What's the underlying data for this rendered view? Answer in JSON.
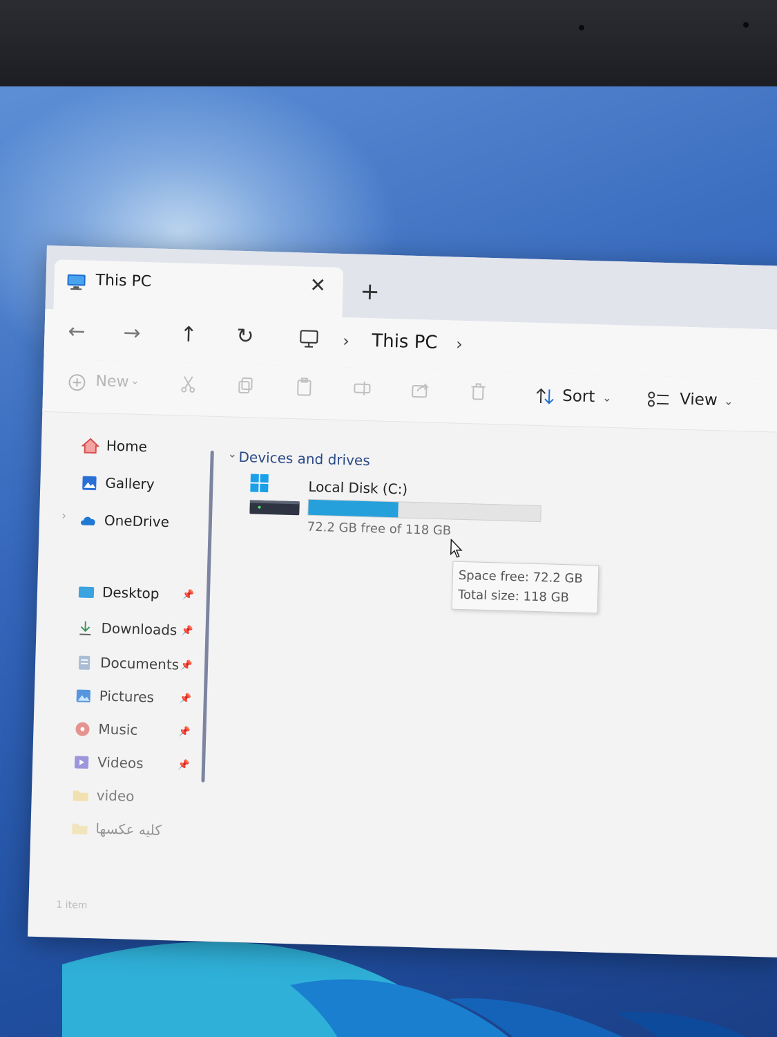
{
  "window": {
    "tab_title": "This PC",
    "close_glyph": "✕",
    "new_tab_glyph": "+"
  },
  "nav": {
    "back_glyph": "←",
    "forward_glyph": "→",
    "up_glyph": "↑",
    "refresh_glyph": "↻",
    "sep_glyph": "›",
    "breadcrumb": "This PC"
  },
  "toolbar": {
    "new_label": "New",
    "new_icon": "plus-circle-icon",
    "sort_label": "Sort",
    "view_label": "View",
    "chevron": "⌄"
  },
  "sidebar": {
    "items": [
      {
        "label": "Home",
        "icon": "home-icon"
      },
      {
        "label": "Gallery",
        "icon": "gallery-icon"
      },
      {
        "label": "OneDrive",
        "icon": "cloud-icon"
      },
      {
        "label": "Desktop",
        "icon": "desktop-folder-icon"
      },
      {
        "label": "Downloads",
        "icon": "download-icon"
      },
      {
        "label": "Documents",
        "icon": "documents-icon"
      },
      {
        "label": "Pictures",
        "icon": "pictures-icon"
      },
      {
        "label": "Music",
        "icon": "music-icon"
      },
      {
        "label": "Videos",
        "icon": "videos-icon"
      },
      {
        "label": "video",
        "icon": "folder-icon"
      },
      {
        "label": "كليه عكسها",
        "icon": "folder-icon"
      }
    ],
    "expand_glyph": "›",
    "pin_glyph": "📌"
  },
  "content": {
    "section_title": "Devices and drives",
    "section_chevron": "⌄",
    "drive": {
      "name": "Local Disk (C:)",
      "free_text": "72.2 GB free of 118 GB",
      "used_fraction": 0.388
    },
    "tooltip": {
      "line1": "Space free: 72.2 GB",
      "line2": "Total size: 118 GB"
    }
  },
  "status": {
    "item_count": "1 item"
  },
  "colors": {
    "accent": "#26a0da",
    "section": "#2b4a86"
  }
}
